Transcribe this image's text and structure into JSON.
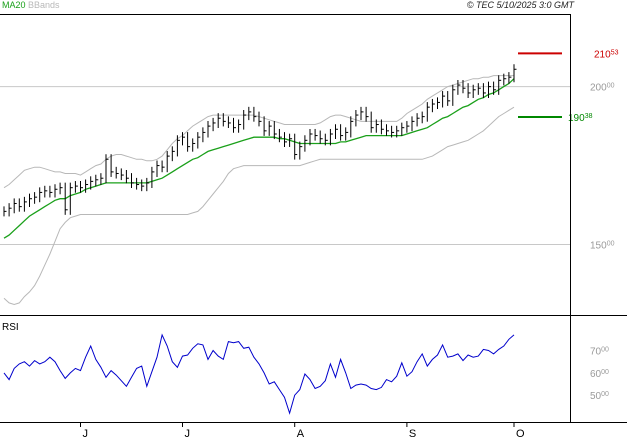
{
  "header": {
    "legend_items": [
      {
        "label": "MA20",
        "color": "#1aa01a"
      },
      {
        "label": "BBands",
        "color": "#b8b8b8"
      }
    ],
    "copyright": "© TEC 5/10/2025 3:0 GMT"
  },
  "colors": {
    "bars": "#000000",
    "ma20": "#1aa01a",
    "bbands": "#b8b8b8",
    "rsi": "#0000cc",
    "resistance": "#cc0000",
    "support": "#008800",
    "grid": "#c8c8c8",
    "frame": "#000000"
  },
  "chart_data": [
    {
      "type": "line",
      "name": "price",
      "ylim": [
        128,
        223
      ],
      "yticks": [
        {
          "value": 200,
          "label": "200",
          "sub": "00"
        },
        {
          "value": 150,
          "label": "150",
          "sub": "00"
        }
      ],
      "x_labels": [
        {
          "index": 15,
          "label": "J"
        },
        {
          "index": 35,
          "label": "J"
        },
        {
          "index": 57,
          "label": "A"
        },
        {
          "index": 79,
          "label": "S"
        },
        {
          "index": 100,
          "label": "O"
        }
      ],
      "close": [
        160.5,
        161.5,
        163,
        162,
        163.5,
        164.5,
        165,
        166.5,
        167,
        166.5,
        167.5,
        168,
        161,
        168,
        168.5,
        168,
        169,
        170,
        170.5,
        171,
        177,
        173,
        172.5,
        172,
        171,
        169.5,
        169,
        168.5,
        169.5,
        173,
        175,
        174.5,
        178,
        179.5,
        183,
        184,
        181,
        182,
        184,
        185.5,
        187.5,
        188.5,
        190,
        189,
        188.5,
        187,
        188,
        191,
        192,
        190.5,
        189,
        186,
        187.5,
        185,
        184,
        182.5,
        183.5,
        178.5,
        181,
        183,
        185,
        184.5,
        183.5,
        183,
        185,
        186.5,
        184.5,
        185.5,
        189,
        191,
        192,
        190.5,
        187,
        188,
        186.5,
        186,
        185.5,
        186,
        187,
        187.5,
        189,
        190,
        190.5,
        193.5,
        194.5,
        195,
        197,
        195.5,
        199,
        200.5,
        199.5,
        198,
        199,
        199.5,
        198,
        200,
        199,
        202,
        202.5,
        203,
        205.5
      ],
      "ma20": [
        152,
        153,
        154.5,
        156,
        157.5,
        159,
        160,
        161,
        162,
        163,
        164,
        164.5,
        164.5,
        165.5,
        166,
        166.5,
        167.5,
        168,
        168.5,
        169,
        169.5,
        169.5,
        169.5,
        169.5,
        169.5,
        169.5,
        169.5,
        169.5,
        169.5,
        170,
        170.5,
        171,
        172,
        173,
        174,
        175,
        176,
        177,
        177.5,
        178.5,
        179.5,
        180,
        180.5,
        181,
        181.5,
        182,
        182.5,
        183,
        183.5,
        184,
        184,
        184,
        184,
        184,
        183.5,
        183.5,
        183,
        182.5,
        182,
        182,
        182,
        182,
        182,
        182,
        182,
        182,
        182.5,
        182.5,
        183,
        183.5,
        184,
        184.5,
        184.5,
        184.5,
        184.5,
        184.5,
        184.5,
        184.5,
        184.5,
        185,
        185.5,
        186,
        186.5,
        187,
        188,
        189,
        190,
        190.5,
        191.5,
        192.5,
        193.5,
        194,
        195,
        196,
        196.5,
        197.5,
        198,
        199,
        200,
        201,
        202.5
      ],
      "bb_upper": [
        168,
        169,
        170.5,
        172,
        173.5,
        174,
        174.5,
        174.5,
        174,
        173.5,
        173,
        173,
        172.5,
        172.5,
        172.5,
        172,
        173,
        174,
        175,
        175.5,
        177,
        178,
        178.5,
        178.5,
        178,
        177.5,
        177,
        177,
        176.5,
        176.5,
        177,
        178,
        180,
        182,
        183.5,
        184.5,
        186,
        187.5,
        188.5,
        189.5,
        190.5,
        191,
        191,
        191,
        191,
        191,
        191,
        191,
        191,
        191,
        190.5,
        190,
        189.5,
        189,
        188.5,
        188,
        188,
        188,
        188,
        188,
        188,
        188,
        188.5,
        189.5,
        190.5,
        191,
        191,
        190.5,
        190,
        189.5,
        189,
        189,
        189,
        189,
        189,
        189,
        189,
        189,
        190,
        191.5,
        192.5,
        193.5,
        194.5,
        196,
        197,
        198,
        199,
        200,
        200.5,
        201,
        201.5,
        202,
        202.5,
        202.5,
        203,
        203,
        203.5,
        203.5,
        203.5,
        203.5,
        203.5
      ],
      "bb_lower": [
        133,
        131.5,
        131,
        131.5,
        133.5,
        135,
        137,
        140,
        143.5,
        147,
        151,
        155,
        157,
        158.5,
        159,
        159.5,
        159.5,
        159.5,
        159.5,
        159.5,
        159.5,
        159.5,
        159.5,
        159.5,
        159.5,
        159.5,
        159.5,
        159.5,
        159.5,
        159.5,
        159.5,
        159.5,
        159.5,
        159.5,
        159.5,
        159.5,
        159.5,
        160,
        160.5,
        162,
        164,
        166,
        168,
        170,
        172.5,
        174,
        174.5,
        175,
        175,
        175,
        175,
        175,
        175,
        175,
        175,
        175,
        175,
        175,
        175,
        175.5,
        176,
        176.5,
        177,
        177,
        177,
        177,
        177,
        177,
        177,
        177,
        177,
        177,
        177,
        177,
        177,
        177,
        177,
        177,
        177,
        177,
        177,
        177,
        177,
        177.5,
        178,
        179,
        180,
        181,
        181.5,
        182,
        182.5,
        183,
        184,
        185,
        186,
        187.5,
        189,
        190.5,
        191.5,
        192.5,
        193.5
      ],
      "levels": [
        {
          "value": 210.53,
          "label": "210",
          "sub": "53",
          "color": "#cc0000"
        },
        {
          "value": 190.38,
          "label": "190",
          "sub": "38",
          "color": "#008800"
        }
      ]
    },
    {
      "type": "line",
      "name": "RSI",
      "title": "RSI",
      "ylim": [
        38,
        85
      ],
      "yticks": [
        {
          "value": 70,
          "label": "70",
          "sub": "00"
        },
        {
          "value": 60,
          "label": "60",
          "sub": "00"
        },
        {
          "value": 50,
          "label": "50",
          "sub": "00"
        }
      ],
      "values": [
        60,
        57,
        62,
        64,
        65,
        63,
        65.5,
        64,
        65,
        67,
        65,
        61,
        57.5,
        60,
        62,
        61,
        67,
        72,
        66,
        62.5,
        58,
        61,
        59,
        56.5,
        54,
        58,
        62,
        63,
        54,
        60.5,
        67,
        77,
        72,
        65,
        62.5,
        67.5,
        68,
        71,
        73,
        72.5,
        66,
        70,
        67.5,
        66,
        74,
        73.5,
        74,
        71,
        71.5,
        67,
        64,
        60,
        55,
        56,
        52.5,
        49,
        42,
        50,
        52.5,
        59.5,
        57,
        53,
        54,
        56.5,
        64,
        58,
        66,
        60,
        53,
        54.5,
        55,
        54.5,
        53,
        52.5,
        53.5,
        57,
        56,
        58.5,
        64.5,
        58.5,
        60.5,
        65,
        68.5,
        63,
        66,
        68,
        72.5,
        67,
        67.5,
        68.5,
        65.5,
        68,
        67,
        67.5,
        70.5,
        70,
        68.5,
        70.5,
        72,
        75,
        77
      ]
    }
  ]
}
